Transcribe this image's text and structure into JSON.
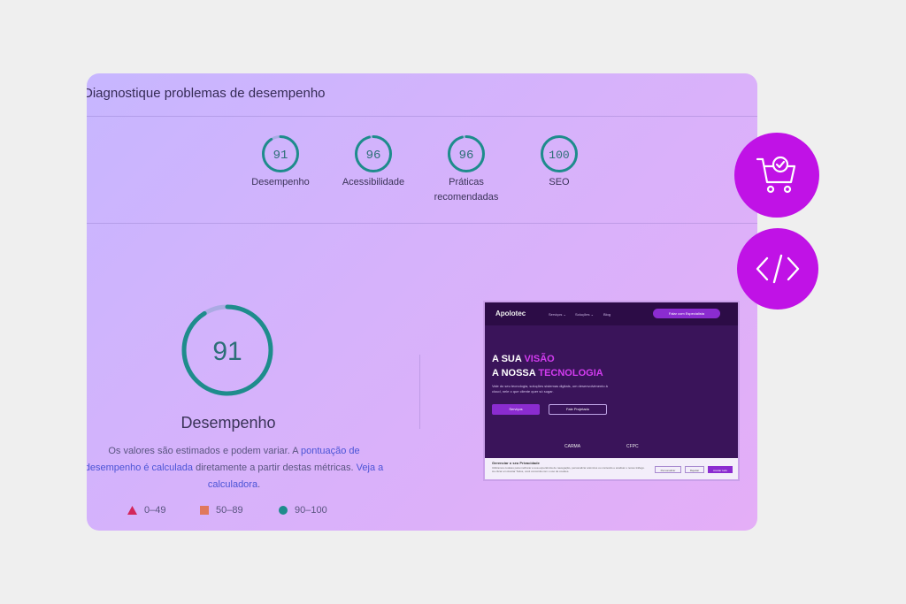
{
  "card": {
    "title": "Diagnostique problemas de desempenho"
  },
  "scores": [
    {
      "value": "91",
      "label": "Desempenho"
    },
    {
      "value": "96",
      "label": "Acessibilidade"
    },
    {
      "value": "96",
      "label": "Práticas recomendadas"
    },
    {
      "value": "100",
      "label": "SEO"
    }
  ],
  "main_score": {
    "value": "91",
    "label": "Desempenho",
    "fraction": 0.91
  },
  "description": {
    "part1": "Os valores são estimados e podem variar. A ",
    "link1": "pontuação de desempenho é calculada",
    "part2": " diretamente a partir destas métricas. ",
    "link2": "Veja a calculadora",
    "part3": "."
  },
  "legend": [
    {
      "range": "0–49",
      "shape": "triangle",
      "color": "#d3265a"
    },
    {
      "range": "50–89",
      "shape": "square",
      "color": "#e0785c"
    },
    {
      "range": "90–100",
      "shape": "circle",
      "color": "#1e8c8c"
    }
  ],
  "screenshot": {
    "brand": "Apolotec",
    "menu": [
      "Serviços ⌄",
      "Soluções ⌄",
      "Blog"
    ],
    "nav_button": "Falar com Especialista",
    "headline1_a": "A SUA ",
    "headline1_b": "VISÃO",
    "headline2_a": "A NOSSA ",
    "headline2_b": "TECNOLOGIA",
    "subtext": "Vale do seu tecnologia, soluções sistemas digitais, um desenvolvimento à cloud, nele o que cliente quer só sugar.",
    "button1": "Serviços",
    "button2": "Fale Projetado",
    "logos": [
      "CARMA",
      "CFPC"
    ],
    "cookie_title": "Gerenciar o seu Privacidade",
    "cookie_text": "Utilizamos cookies para melhorar a sua experiência de navegação, personalizar anúncios ou conteúdo e analisar o nosso tráfego. Ao clicar em Aceitar Todos, você concorda com o uso de cookies.",
    "cookie_buttons": [
      "Personalizar",
      "Rejeitar",
      "Aceitar tudo"
    ]
  },
  "side_buttons": [
    {
      "icon": "shopping-cart-check-icon"
    },
    {
      "icon": "code-icon"
    }
  ],
  "colors": {
    "gauge_good": "#1e8c8c",
    "accent": "#c012e6"
  }
}
